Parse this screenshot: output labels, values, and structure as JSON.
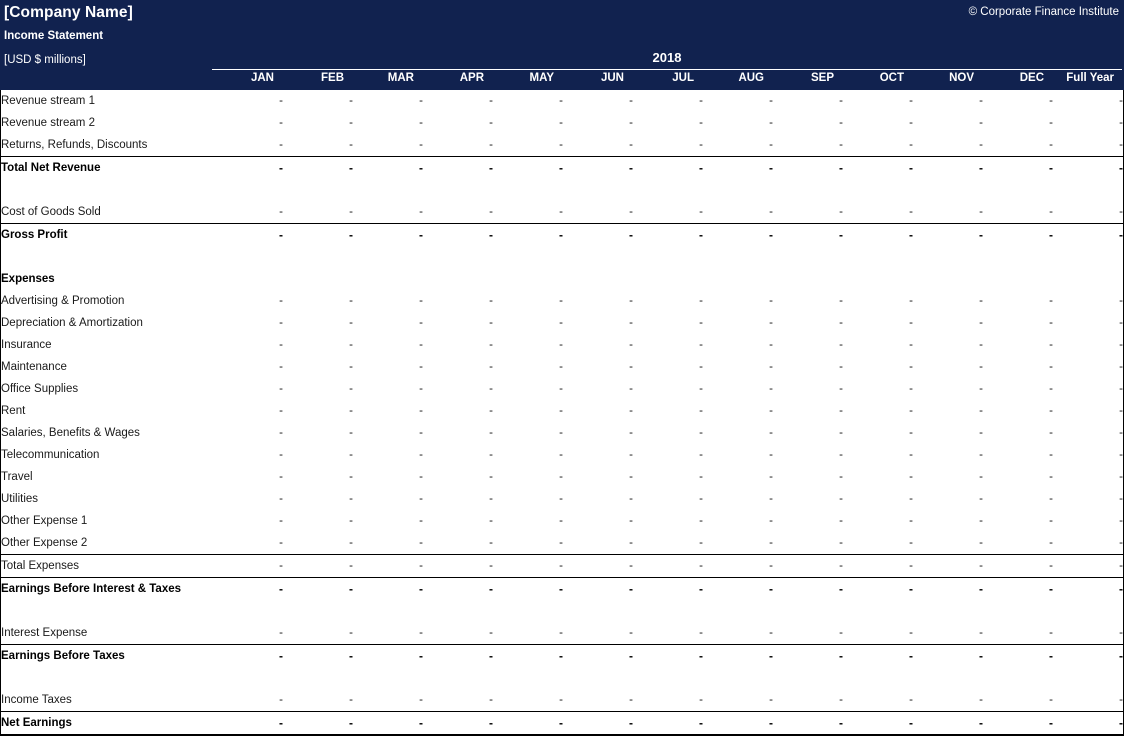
{
  "header": {
    "company_name": "[Company Name]",
    "statement_name": "Income Statement",
    "units": "[USD $ millions]",
    "copyright": "© Corporate Finance Institute",
    "year": "2018"
  },
  "columns": [
    {
      "key": "jan",
      "label": "JAN"
    },
    {
      "key": "feb",
      "label": "FEB"
    },
    {
      "key": "mar",
      "label": "MAR"
    },
    {
      "key": "apr",
      "label": "APR"
    },
    {
      "key": "may",
      "label": "MAY"
    },
    {
      "key": "jun",
      "label": "JUN"
    },
    {
      "key": "jul",
      "label": "JUL"
    },
    {
      "key": "aug",
      "label": "AUG"
    },
    {
      "key": "sep",
      "label": "SEP"
    },
    {
      "key": "oct",
      "label": "OCT"
    },
    {
      "key": "nov",
      "label": "NOV"
    },
    {
      "key": "dec",
      "label": "DEC"
    },
    {
      "key": "full_year",
      "label": "Full Year"
    }
  ],
  "empty_value": "-",
  "rows": [
    {
      "label": "Revenue stream 1",
      "style": "normal",
      "has_values": true,
      "values": [
        "-",
        "-",
        "-",
        "-",
        "-",
        "-",
        "-",
        "-",
        "-",
        "-",
        "-",
        "-",
        "-"
      ]
    },
    {
      "label": "Revenue stream 2",
      "style": "normal",
      "has_values": true,
      "values": [
        "-",
        "-",
        "-",
        "-",
        "-",
        "-",
        "-",
        "-",
        "-",
        "-",
        "-",
        "-",
        "-"
      ]
    },
    {
      "label": "Returns, Refunds, Discounts",
      "style": "normal",
      "has_values": true,
      "values": [
        "-",
        "-",
        "-",
        "-",
        "-",
        "-",
        "-",
        "-",
        "-",
        "-",
        "-",
        "-",
        "-"
      ]
    },
    {
      "label": "Total Net Revenue",
      "style": "bold",
      "rule": "top",
      "has_values": true,
      "values": [
        "-",
        "-",
        "-",
        "-",
        "-",
        "-",
        "-",
        "-",
        "-",
        "-",
        "-",
        "-",
        "-"
      ]
    },
    {
      "label": "",
      "style": "spacer",
      "has_values": false,
      "values": []
    },
    {
      "label": "Cost of Goods Sold",
      "style": "normal",
      "has_values": true,
      "values": [
        "-",
        "-",
        "-",
        "-",
        "-",
        "-",
        "-",
        "-",
        "-",
        "-",
        "-",
        "-",
        "-"
      ]
    },
    {
      "label": "Gross Profit",
      "style": "bold",
      "rule": "top",
      "has_values": true,
      "values": [
        "-",
        "-",
        "-",
        "-",
        "-",
        "-",
        "-",
        "-",
        "-",
        "-",
        "-",
        "-",
        "-"
      ]
    },
    {
      "label": "",
      "style": "spacer",
      "has_values": false,
      "values": []
    },
    {
      "label": "Expenses",
      "style": "bold",
      "has_values": false,
      "values": []
    },
    {
      "label": "Advertising & Promotion",
      "style": "normal",
      "has_values": true,
      "values": [
        "-",
        "-",
        "-",
        "-",
        "-",
        "-",
        "-",
        "-",
        "-",
        "-",
        "-",
        "-",
        "-"
      ]
    },
    {
      "label": "Depreciation & Amortization",
      "style": "normal",
      "has_values": true,
      "values": [
        "-",
        "-",
        "-",
        "-",
        "-",
        "-",
        "-",
        "-",
        "-",
        "-",
        "-",
        "-",
        "-"
      ]
    },
    {
      "label": "Insurance",
      "style": "normal",
      "has_values": true,
      "values": [
        "-",
        "-",
        "-",
        "-",
        "-",
        "-",
        "-",
        "-",
        "-",
        "-",
        "-",
        "-",
        "-"
      ]
    },
    {
      "label": "Maintenance",
      "style": "normal",
      "has_values": true,
      "values": [
        "-",
        "-",
        "-",
        "-",
        "-",
        "-",
        "-",
        "-",
        "-",
        "-",
        "-",
        "-",
        "-"
      ]
    },
    {
      "label": "Office Supplies",
      "style": "normal",
      "has_values": true,
      "values": [
        "-",
        "-",
        "-",
        "-",
        "-",
        "-",
        "-",
        "-",
        "-",
        "-",
        "-",
        "-",
        "-"
      ]
    },
    {
      "label": "Rent",
      "style": "normal",
      "has_values": true,
      "values": [
        "-",
        "-",
        "-",
        "-",
        "-",
        "-",
        "-",
        "-",
        "-",
        "-",
        "-",
        "-",
        "-"
      ]
    },
    {
      "label": "Salaries, Benefits & Wages",
      "style": "normal",
      "has_values": true,
      "values": [
        "-",
        "-",
        "-",
        "-",
        "-",
        "-",
        "-",
        "-",
        "-",
        "-",
        "-",
        "-",
        "-"
      ]
    },
    {
      "label": "Telecommunication",
      "style": "normal",
      "has_values": true,
      "values": [
        "-",
        "-",
        "-",
        "-",
        "-",
        "-",
        "-",
        "-",
        "-",
        "-",
        "-",
        "-",
        "-"
      ]
    },
    {
      "label": "Travel",
      "style": "normal",
      "has_values": true,
      "values": [
        "-",
        "-",
        "-",
        "-",
        "-",
        "-",
        "-",
        "-",
        "-",
        "-",
        "-",
        "-",
        "-"
      ]
    },
    {
      "label": "Utilities",
      "style": "normal",
      "has_values": true,
      "values": [
        "-",
        "-",
        "-",
        "-",
        "-",
        "-",
        "-",
        "-",
        "-",
        "-",
        "-",
        "-",
        "-"
      ]
    },
    {
      "label": "Other Expense 1",
      "style": "normal",
      "has_values": true,
      "values": [
        "-",
        "-",
        "-",
        "-",
        "-",
        "-",
        "-",
        "-",
        "-",
        "-",
        "-",
        "-",
        "-"
      ]
    },
    {
      "label": "Other Expense 2",
      "style": "normal",
      "has_values": true,
      "values": [
        "-",
        "-",
        "-",
        "-",
        "-",
        "-",
        "-",
        "-",
        "-",
        "-",
        "-",
        "-",
        "-"
      ]
    },
    {
      "label": "Total Expenses",
      "style": "normal",
      "rule": "top",
      "has_values": true,
      "values": [
        "-",
        "-",
        "-",
        "-",
        "-",
        "-",
        "-",
        "-",
        "-",
        "-",
        "-",
        "-",
        "-"
      ]
    },
    {
      "label": "Earnings Before Interest & Taxes",
      "style": "bold",
      "rule": "top",
      "has_values": true,
      "values": [
        "-",
        "-",
        "-",
        "-",
        "-",
        "-",
        "-",
        "-",
        "-",
        "-",
        "-",
        "-",
        "-"
      ]
    },
    {
      "label": "",
      "style": "spacer",
      "has_values": false,
      "values": []
    },
    {
      "label": "Interest Expense",
      "style": "normal",
      "has_values": true,
      "values": [
        "-",
        "-",
        "-",
        "-",
        "-",
        "-",
        "-",
        "-",
        "-",
        "-",
        "-",
        "-",
        "-"
      ]
    },
    {
      "label": "Earnings Before Taxes",
      "style": "bold",
      "rule": "top",
      "has_values": true,
      "values": [
        "-",
        "-",
        "-",
        "-",
        "-",
        "-",
        "-",
        "-",
        "-",
        "-",
        "-",
        "-",
        "-"
      ]
    },
    {
      "label": "",
      "style": "spacer",
      "has_values": false,
      "values": []
    },
    {
      "label": "Income Taxes",
      "style": "normal",
      "has_values": true,
      "values": [
        "-",
        "-",
        "-",
        "-",
        "-",
        "-",
        "-",
        "-",
        "-",
        "-",
        "-",
        "-",
        "-"
      ]
    },
    {
      "label": "Net Earnings",
      "style": "bold",
      "rule": "topbottom",
      "has_values": true,
      "values": [
        "-",
        "-",
        "-",
        "-",
        "-",
        "-",
        "-",
        "-",
        "-",
        "-",
        "-",
        "-",
        "-"
      ]
    }
  ],
  "colors": {
    "header_navy": "#11224f",
    "header_text": "#ffffff",
    "body_background": "#ffffff",
    "label_text": "#1a1a1a",
    "value_text": "#1f2f6e",
    "border": "#000000"
  }
}
